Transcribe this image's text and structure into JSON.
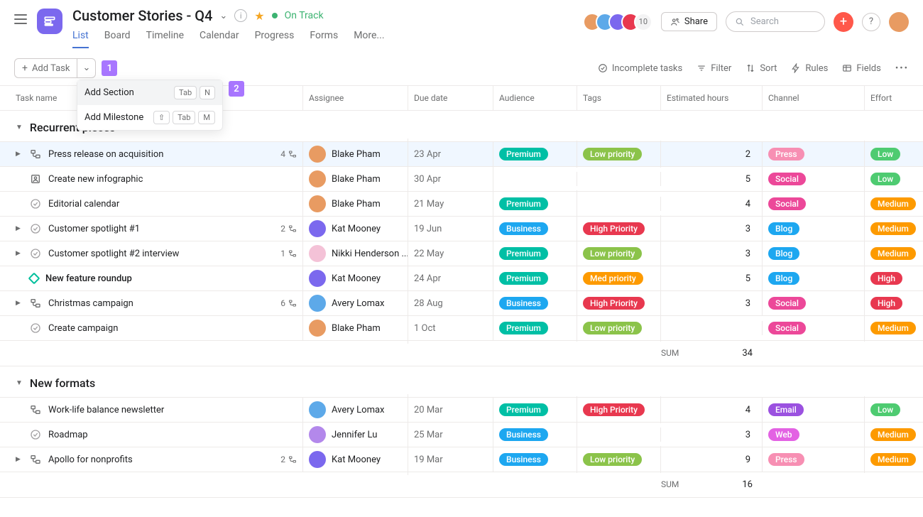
{
  "header": {
    "title": "Customer Stories - Q4",
    "status": "On Track",
    "memberCount": "10",
    "share": "Share",
    "searchPlaceholder": "Search"
  },
  "tabs": [
    "List",
    "Board",
    "Timeline",
    "Calendar",
    "Progress",
    "Forms",
    "More..."
  ],
  "activeTab": 0,
  "toolbar": {
    "addTask": "Add Task",
    "dropdown": {
      "addSection": "Add Section",
      "addSectionKeys": [
        "Tab",
        "N"
      ],
      "addMilestone": "Add Milestone",
      "addMilestoneKeys": [
        "⇧",
        "Tab",
        "M"
      ]
    },
    "callout1": "1",
    "callout2": "2",
    "right": {
      "incomplete": "Incomplete tasks",
      "filter": "Filter",
      "sort": "Sort",
      "rules": "Rules",
      "fields": "Fields"
    }
  },
  "columns": {
    "task": "Task name",
    "assignee": "Assignee",
    "due": "Due date",
    "audience": "Audience",
    "tags": "Tags",
    "hours": "Estimated hours",
    "channel": "Channel",
    "effort": "Effort"
  },
  "pillColors": {
    "Premium": "#00bfa5",
    "Business": "#1da7f0",
    "Low priority": "#8bc34a",
    "High Priority": "#e8384f",
    "Med priority": "#fd9a00",
    "Press": "#f78fb3",
    "Social": "#ec4899",
    "Blog": "#1da7f0",
    "Email": "#9b51e0",
    "Web": "#e362e3",
    "Low": "#4ecb71",
    "Medium": "#fd9a00",
    "High": "#e8384f"
  },
  "avatarColors": {
    "Blake Pham": "#e89b62",
    "Kat Mooney": "#7b68ee",
    "Nikki Henderson ...": "#f4c2d7",
    "Avery Lomax": "#5da9e9",
    "Jennifer Lu": "#b388eb"
  },
  "sections": [
    {
      "name": "Recurrent pieces",
      "sum": "34",
      "sumLabel": "SUM",
      "rows": [
        {
          "expand": true,
          "icon": "subtask",
          "name": "Press release on acquisition",
          "sub": "4",
          "assignee": "Blake Pham",
          "due": "23 Apr",
          "audience": "Premium",
          "tag": "Low priority",
          "hours": "2",
          "channel": "Press",
          "effort": "Low",
          "highlight": true
        },
        {
          "expand": false,
          "icon": "person",
          "name": "Create new infographic",
          "assignee": "Blake Pham",
          "due": "30 Apr",
          "hours": "5",
          "channel": "Social",
          "effort": "Low"
        },
        {
          "expand": false,
          "icon": "check",
          "name": "Editorial calendar",
          "assignee": "Blake Pham",
          "due": "21 May",
          "audience": "Premium",
          "hours": "4",
          "channel": "Social",
          "effort": "Medium"
        },
        {
          "expand": true,
          "icon": "check",
          "name": "Customer spotlight #1",
          "sub": "2",
          "assignee": "Kat Mooney",
          "due": "19 Jun",
          "audience": "Business",
          "tag": "High Priority",
          "hours": "3",
          "channel": "Blog",
          "effort": "Medium"
        },
        {
          "expand": true,
          "icon": "check",
          "name": "Customer spotlight #2 interview",
          "sub": "1",
          "assignee": "Nikki Henderson ...",
          "due": "22 May",
          "audience": "Premium",
          "tag": "Low priority",
          "hours": "3",
          "channel": "Blog",
          "effort": "Medium"
        },
        {
          "expand": false,
          "icon": "diamond",
          "name": "New feature roundup",
          "bold": true,
          "assignee": "Kat Mooney",
          "due": "24 Apr",
          "audience": "Premium",
          "tag": "Med priority",
          "hours": "5",
          "channel": "Blog",
          "effort": "High"
        },
        {
          "expand": true,
          "icon": "subtask",
          "name": "Christmas campaign",
          "sub": "6",
          "assignee": "Avery Lomax",
          "due": "28 Aug",
          "audience": "Business",
          "tag": "High Priority",
          "hours": "3",
          "channel": "Social",
          "effort": "High"
        },
        {
          "expand": false,
          "icon": "check",
          "name": "Create campaign",
          "assignee": "Blake Pham",
          "due": "1 Oct",
          "audience": "Premium",
          "tag": "Low priority",
          "channel": "Social",
          "effort": "Medium"
        }
      ]
    },
    {
      "name": "New formats",
      "sum": "16",
      "sumLabel": "SUM",
      "rows": [
        {
          "expand": false,
          "icon": "subtask",
          "name": "Work-life balance newsletter",
          "assignee": "Avery Lomax",
          "due": "20 Mar",
          "audience": "Premium",
          "tag": "High Priority",
          "hours": "4",
          "channel": "Email",
          "effort": "Low"
        },
        {
          "expand": false,
          "icon": "check",
          "name": "Roadmap",
          "assignee": "Jennifer Lu",
          "due": "25 Mar",
          "audience": "Business",
          "hours": "3",
          "channel": "Web",
          "effort": "Medium"
        },
        {
          "expand": true,
          "icon": "subtask",
          "name": "Apollo for nonprofits",
          "sub": "2",
          "assignee": "Kat Mooney",
          "due": "19 Mar",
          "audience": "Business",
          "tag": "Low priority",
          "hours": "9",
          "channel": "Press",
          "effort": "Medium"
        }
      ]
    }
  ]
}
